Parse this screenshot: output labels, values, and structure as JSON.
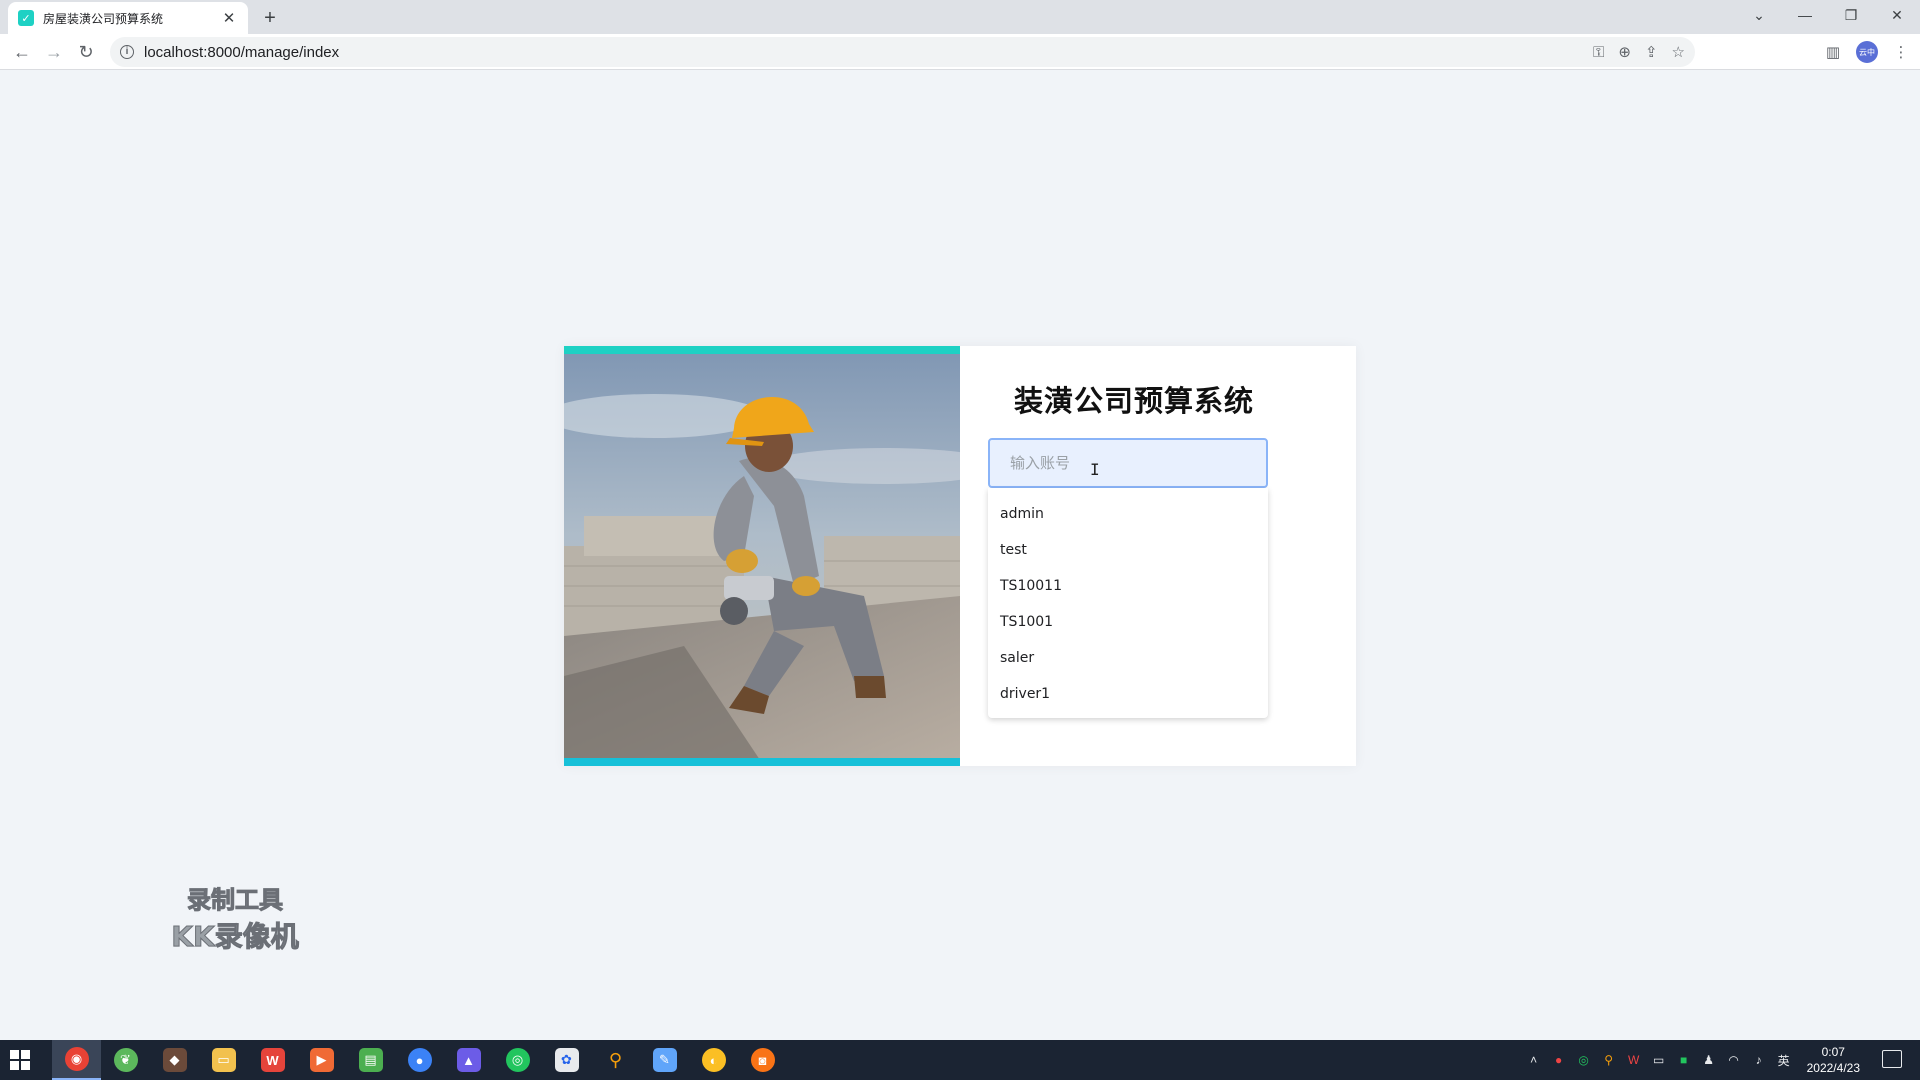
{
  "browser": {
    "tab_title": "房屋装潢公司预算系统",
    "url": "localhost:8000/manage/index",
    "profile_label": "云中",
    "colors": {
      "favicon": "#1ed1c4"
    }
  },
  "login": {
    "title": "装潢公司预算系统",
    "account_placeholder": "输入账号",
    "suggestions": [
      "admin",
      "test",
      "TS10011",
      "TS1001",
      "saler",
      "driver1"
    ]
  },
  "watermark": {
    "line1": "录制工具",
    "line2": "KK录像机"
  },
  "taskbar": {
    "ime_label": "英",
    "time": "0:07",
    "date": "2022/4/23"
  }
}
